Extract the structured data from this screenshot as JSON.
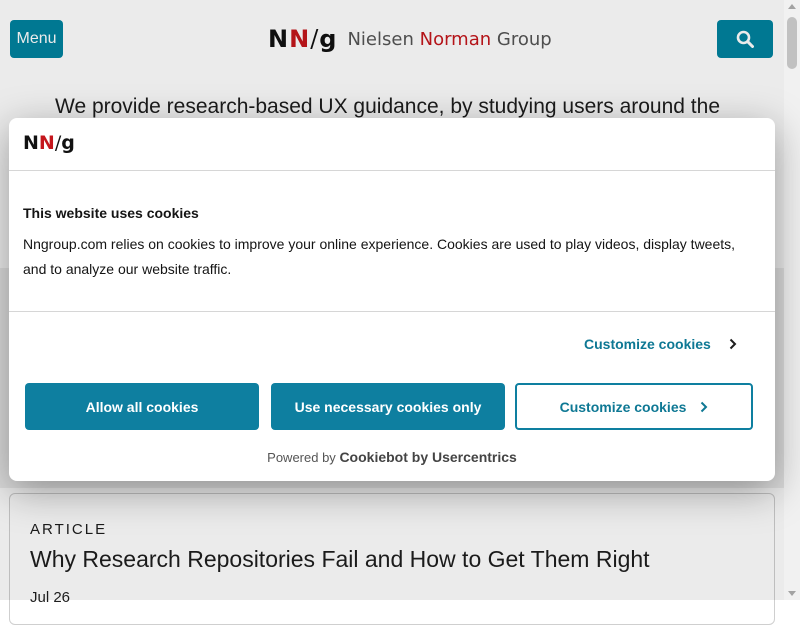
{
  "header": {
    "menu_label": "Menu",
    "search_icon": "search-icon",
    "logo_mark_left": "NN",
    "logo_mark_slash": "/",
    "logo_mark_right": "g",
    "logo_word1": "Nielsen",
    "logo_word2": "Norman",
    "logo_word3": "Group"
  },
  "tagline": "We provide research-based UX guidance, by studying users around the",
  "article": {
    "kicker": "ARTICLE",
    "title": "Why Research Repositories Fail and How to Get Them Right",
    "date": "Jul 26"
  },
  "cookie_dialog": {
    "logo_left": "NN",
    "logo_slash": "/",
    "logo_right": "g",
    "heading": "This website uses cookies",
    "body": "Nngroup.com relies on cookies to improve your online experience. Cookies are used to play videos, display tweets, and to analyze our website traffic.",
    "customize_link": "Customize cookies",
    "allow_all": "Allow all cookies",
    "necessary_only": "Use necessary cookies only",
    "customize_button": "Customize cookies",
    "powered_prefix": "Powered by",
    "powered_brand": "Cookiebot by Usercentrics"
  },
  "colors": {
    "accent": "#0e7fa0",
    "brand_red": "#c4161c"
  }
}
